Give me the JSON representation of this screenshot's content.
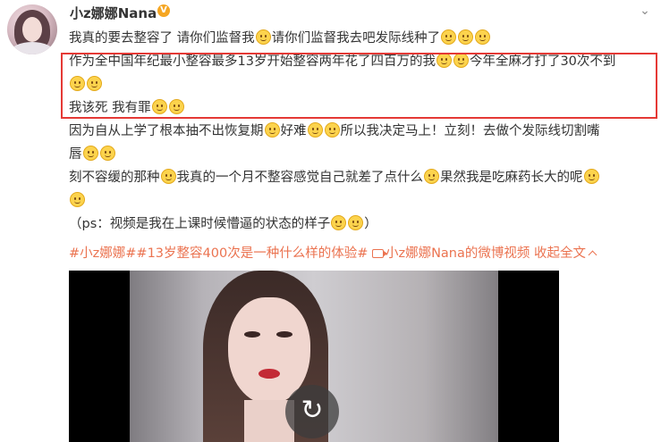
{
  "user": {
    "name": "小z娜娜Nana",
    "verified_badge": "V"
  },
  "post": {
    "lines": [
      "我真的要去整容了 请你们监督我",
      "请你们监督我去吧发际线种了",
      "作为全中国年纪最小整容最多13岁开始整容两年花了四百万的我",
      "今年全麻才打了30次不到",
      "我该死 我有罪",
      "因为自从上学了根本抽不出恢复期",
      "好难",
      "所以我决定马上！立刻！去做个发际线切割嘴",
      "唇",
      "刻不容缓的那种",
      "我真的一个月不整容感觉自己就差了点什么",
      "果然我是吃麻药长大的呢",
      "（ps：视频是我在上课时候懵逼的状态的样子",
      "）"
    ]
  },
  "hashtags": {
    "tag1": "#小z娜娜#",
    "tag2": "#13岁整容400次是一种什么样的体验#",
    "video_link": "小z娜娜Nana的微博视频",
    "collapse": "收起全文"
  },
  "icons": {
    "more": "chevron-down-icon",
    "emoji": "smile-emoji-icon",
    "replay": "replay-icon"
  },
  "colors": {
    "link": "#eb7350",
    "highlight_box": "#e53935",
    "verified": "#f5a623"
  }
}
